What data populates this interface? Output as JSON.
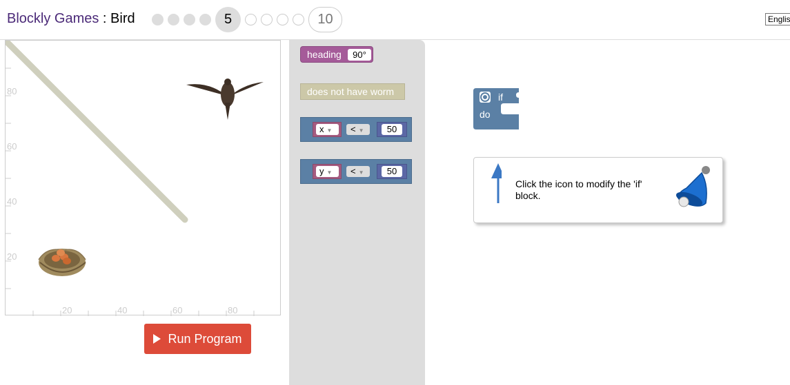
{
  "header": {
    "app_name": "Blockly Games",
    "separator": " : ",
    "game_name": "Bird",
    "current_level": "5",
    "last_level": "10",
    "language": "English"
  },
  "visualization": {
    "y_axis_ticks": [
      "80",
      "60",
      "40",
      "20"
    ],
    "x_axis_ticks": [
      "20",
      "40",
      "60",
      "80"
    ],
    "colors": {
      "wall": "#cfcfbd",
      "tick": "#ccc"
    }
  },
  "run_button": {
    "label": "Run Program",
    "color": "#dd4b39"
  },
  "flyout": {
    "heading_block": {
      "label": "heading",
      "value": "90°",
      "color": "#a55b99"
    },
    "worm_block": {
      "label": "does not have worm",
      "color": "#ccc8a8"
    },
    "compare_blocks": [
      {
        "variable": "x",
        "operator": "<",
        "value": "50"
      },
      {
        "variable": "y",
        "operator": "<",
        "value": "50"
      }
    ]
  },
  "workspace": {
    "if_block": {
      "if_label": "if",
      "do_label": "do",
      "color": "#5b80a5"
    },
    "help": {
      "text": "Click the icon to modify the 'if' block.",
      "bell_icon": "bell-icon",
      "arrow_icon": "up-arrow-icon"
    }
  }
}
